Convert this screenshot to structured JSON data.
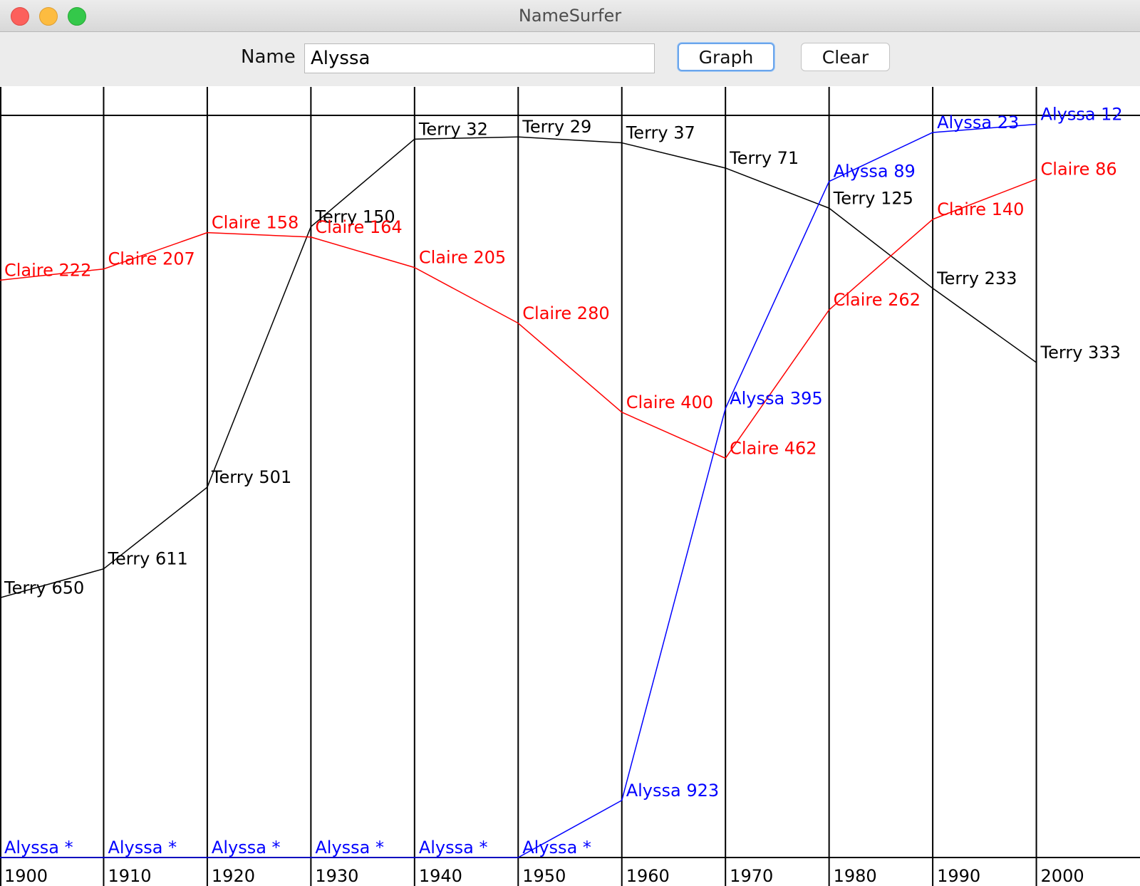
{
  "window": {
    "title": "NameSurfer"
  },
  "toolbar": {
    "name_label": "Name",
    "name_value": "Alyssa",
    "graph_label": "Graph",
    "clear_label": "Clear"
  },
  "chart_data": {
    "type": "line",
    "x": [
      "1900",
      "1910",
      "1920",
      "1930",
      "1940",
      "1950",
      "1960",
      "1970",
      "1980",
      "1990",
      "2000"
    ],
    "ylim": [
      1,
      1000
    ],
    "y_inverted": true,
    "grid": true,
    "series": [
      {
        "name": "Terry",
        "color": "#000000",
        "values": [
          650,
          611,
          501,
          150,
          32,
          29,
          37,
          71,
          125,
          233,
          333
        ],
        "labels": [
          "Terry 650",
          "Terry 611",
          "Terry 501",
          "Terry 150",
          "Terry 32",
          "Terry 29",
          "Terry 37",
          "Terry 71",
          "Terry 125",
          "Terry 233",
          "Terry 333"
        ]
      },
      {
        "name": "Claire",
        "color": "#ff0000",
        "values": [
          222,
          207,
          158,
          164,
          205,
          280,
          400,
          462,
          262,
          140,
          86
        ],
        "labels": [
          "Claire 222",
          "Claire 207",
          "Claire 158",
          "Claire 164",
          "Claire 205",
          "Claire 280",
          "Claire 400",
          "Claire 462",
          "Claire 262",
          "Claire 140",
          "Claire 86"
        ]
      },
      {
        "name": "Alyssa",
        "color": "#0000ff",
        "values": [
          null,
          null,
          null,
          null,
          null,
          null,
          923,
          395,
          89,
          23,
          12
        ],
        "labels": [
          "Alyssa *",
          "Alyssa *",
          "Alyssa *",
          "Alyssa *",
          "Alyssa *",
          "Alyssa *",
          "Alyssa 923",
          "Alyssa 395",
          "Alyssa 89",
          "Alyssa 23",
          "Alyssa 12"
        ]
      }
    ]
  }
}
